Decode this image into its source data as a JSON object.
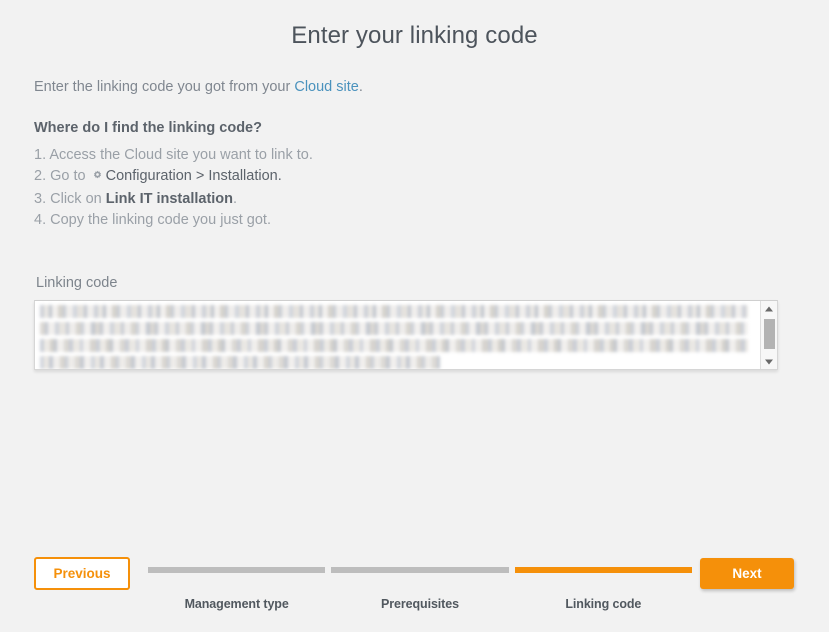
{
  "page": {
    "title": "Enter your linking code",
    "background_color": "#f2f2f2"
  },
  "intro": {
    "text_before": "Enter the linking code you got from your ",
    "link_text": "Cloud site",
    "text_after": ".",
    "link_color": "#4a92bd"
  },
  "howto": {
    "heading": "Where do I find the linking code?",
    "steps": [
      {
        "number": "1.",
        "parts": [
          {
            "text": " Access the Cloud site you want to link to.",
            "style": "normal"
          }
        ]
      },
      {
        "number": "2.",
        "parts": [
          {
            "text": " Go to ",
            "style": "normal"
          },
          {
            "text": "gear-icon",
            "style": "icon"
          },
          {
            "text": " Configuration > Installation.",
            "style": "emph"
          }
        ]
      },
      {
        "number": "3.",
        "parts": [
          {
            "text": " Click on ",
            "style": "normal"
          },
          {
            "text": "Link IT installation",
            "style": "strong"
          },
          {
            "text": ".",
            "style": "normal"
          }
        ]
      },
      {
        "number": "4.",
        "parts": [
          {
            "text": " Copy the linking code you just got.",
            "style": "normal"
          }
        ]
      }
    ],
    "step_1_full": "1. Access the Cloud site you want to link to.",
    "step_2_prefix": "2. Go to",
    "step_2_suffix": "Configuration > Installation.",
    "step_3_prefix": "3. Click on",
    "step_3_bold": "Link IT installation",
    "step_3_suffix": ".",
    "step_4_full": "4. Copy the linking code you just got."
  },
  "linking_code_field": {
    "label": "Linking code",
    "value": "",
    "placeholder": "",
    "content_redacted": true,
    "scrollbar": {
      "up_arrow": "triangle-up",
      "down_arrow": "triangle-down",
      "thumb_color": "#b3b3b3"
    }
  },
  "footer": {
    "previous_label": "Previous",
    "next_label": "Next",
    "accent_color": "#f5900a",
    "inactive_color": "#bdbdbd",
    "steps": [
      {
        "label": "Management type",
        "state": "inactive"
      },
      {
        "label": "Prerequisites",
        "state": "inactive"
      },
      {
        "label": "Linking code",
        "state": "active"
      }
    ]
  }
}
